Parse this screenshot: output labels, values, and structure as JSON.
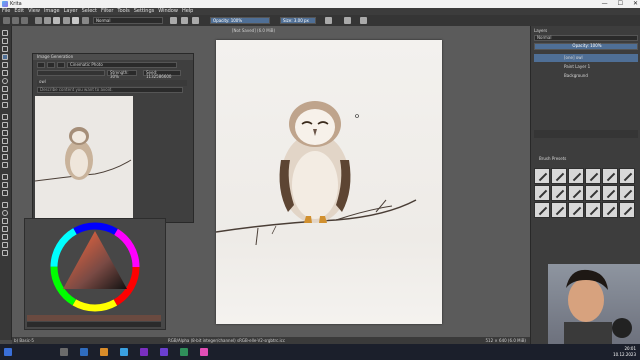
{
  "app": {
    "title": "Krita",
    "window_buttons": [
      "—",
      "☐",
      "✕"
    ]
  },
  "menu": [
    "File",
    "Edit",
    "View",
    "Image",
    "Layer",
    "Select",
    "Filter",
    "Tools",
    "Settings",
    "Window",
    "Help"
  ],
  "toolbar": {
    "blend_mode": "Normal",
    "opacity": "Opacity: 100%",
    "size": "Size: 3.00 px"
  },
  "document": {
    "tab_title": "[Not Saved] (6.0 MiB)"
  },
  "image_generation": {
    "title": "Image Generation",
    "style": "Cinematic Photo",
    "strength": "Strength: 30%",
    "seed": "Seed: 1132586600",
    "prompt": "owl",
    "negative_placeholder": "Describe content you want to avoid."
  },
  "layers": {
    "title": "Layers",
    "mode": "Normal",
    "opacity": "Opacity: 100%",
    "items": [
      {
        "name": "[one] owl"
      },
      {
        "name": "Paint Layer 1"
      },
      {
        "name": "Background"
      }
    ]
  },
  "brush_presets": {
    "title": "Brush Presets"
  },
  "status": {
    "left": "b) Basic-5",
    "center": "RGB/Alpha (8-bit integer/channel) sRGB-elle-V2-srgbtrc.icc",
    "right": "512 × 640 (6.0 MiB)"
  },
  "taskbar": {
    "time": "20:01",
    "date": "10.12.2023"
  },
  "colors": {
    "accent": "#4f6f96",
    "panel": "#3f3f3f"
  }
}
